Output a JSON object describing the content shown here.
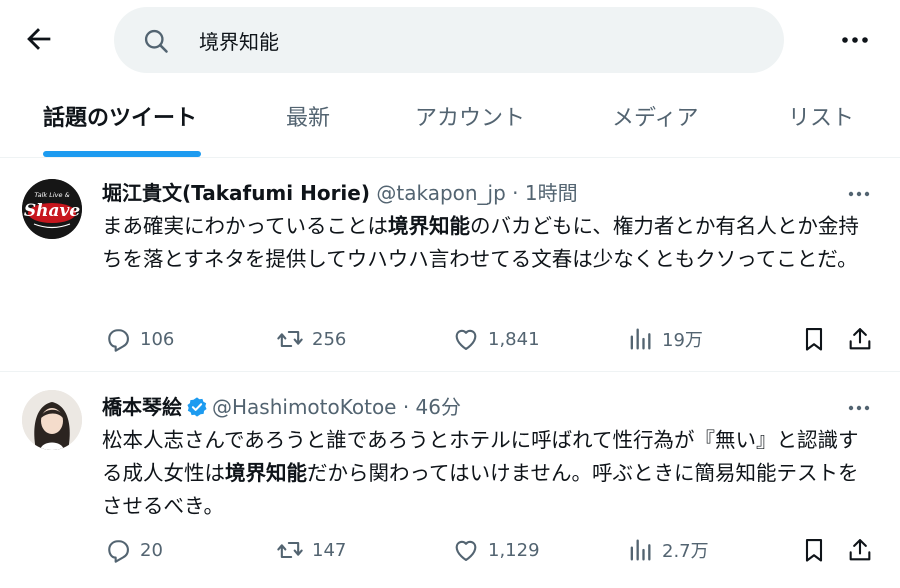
{
  "header": {
    "search_value": "境界知能",
    "back_icon": "arrow-left-icon",
    "more_icon": "more-horizontal-icon"
  },
  "tabs": [
    {
      "label": "話題のツイート",
      "active": true
    },
    {
      "label": "最新",
      "active": false
    },
    {
      "label": "アカウント",
      "active": false
    },
    {
      "label": "メディア",
      "active": false
    },
    {
      "label": "リスト",
      "active": false
    }
  ],
  "colors": {
    "accent": "#1d9bf0",
    "text": "#0f1419",
    "muted": "#536471"
  },
  "tweets": [
    {
      "name": "堀江貴文(Takafumi Horie)",
      "handle": "@takapon_jp",
      "time": "· 1時間",
      "verified": false,
      "text_parts": [
        "まあ確実にわかっていることは",
        "境界知能",
        "のバカどもに、権力者とか有名人とか金持ちを落とすネタを提供してウハウハ言わせてる文春は少なくともクソってことだ。"
      ],
      "replies": "106",
      "retweets": "256",
      "likes": "1,841",
      "views": "19万",
      "avatar_text": {
        "top": "Talk Live &",
        "main": "Shave"
      }
    },
    {
      "name": "橋本琴絵",
      "handle": "@HashimotoKotoe",
      "time": "· 46分",
      "verified": true,
      "text_parts": [
        "松本人志さんであろうと誰であろうとホテルに呼ばれて性行為が『無い』と認識する成人女性は",
        "境界知能",
        "だから関わってはいけません。呼ぶときに簡易知能テストをさせるべき。"
      ],
      "replies": "20",
      "retweets": "147",
      "likes": "1,129",
      "views": "2.7万"
    }
  ]
}
